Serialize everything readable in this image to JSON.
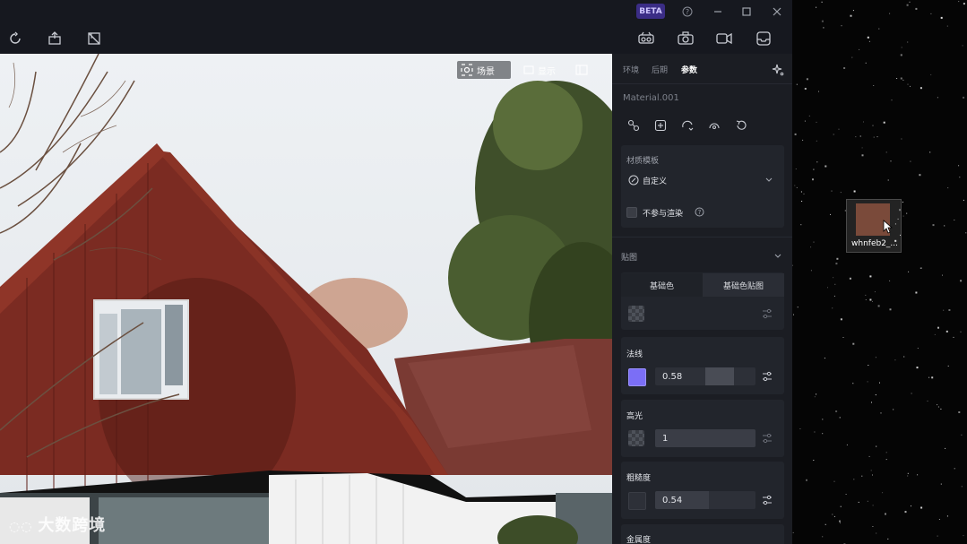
{
  "titlebar": {
    "beta_label": "BETA",
    "icons": [
      "help-icon",
      "minimize-icon",
      "maximize-icon",
      "close-icon"
    ]
  },
  "toolbar": {
    "left_icons": [
      "refresh-icon",
      "import-icon",
      "frame-icon"
    ],
    "right_icons": [
      "vr-icon",
      "camera-icon",
      "video-icon",
      "inbox-icon"
    ]
  },
  "viewport": {
    "scene_label": "场景",
    "display_label": "显示"
  },
  "panel": {
    "tabs": [
      {
        "label": "环境",
        "active": false
      },
      {
        "label": "后期",
        "active": false
      },
      {
        "label": "参数",
        "active": true
      }
    ],
    "material_name": "Material.001",
    "template_section": {
      "title": "材质模板",
      "selected": "自定义",
      "exclude_render_label": "不参与渲染"
    },
    "maps_section": {
      "title": "贴图",
      "subtabs": [
        "基础色",
        "基础色贴图"
      ],
      "active_subtab": 1
    },
    "normal": {
      "label": "法线",
      "value": "0.58",
      "fraction": 0.58,
      "color": "#7b6ef6"
    },
    "specular": {
      "label": "高光",
      "value": "1",
      "fraction": 1.0
    },
    "roughness": {
      "label": "粗糙度",
      "value": "0.54",
      "fraction": 0.54
    },
    "metallic": {
      "label": "金属度"
    }
  },
  "desktop": {
    "file_name": "whnfeb2_...",
    "file_color": "#7a4a3a"
  },
  "watermark": "大数跨境",
  "colors": {
    "accent": "#3b2d86",
    "house_red": "#7e2d24"
  }
}
